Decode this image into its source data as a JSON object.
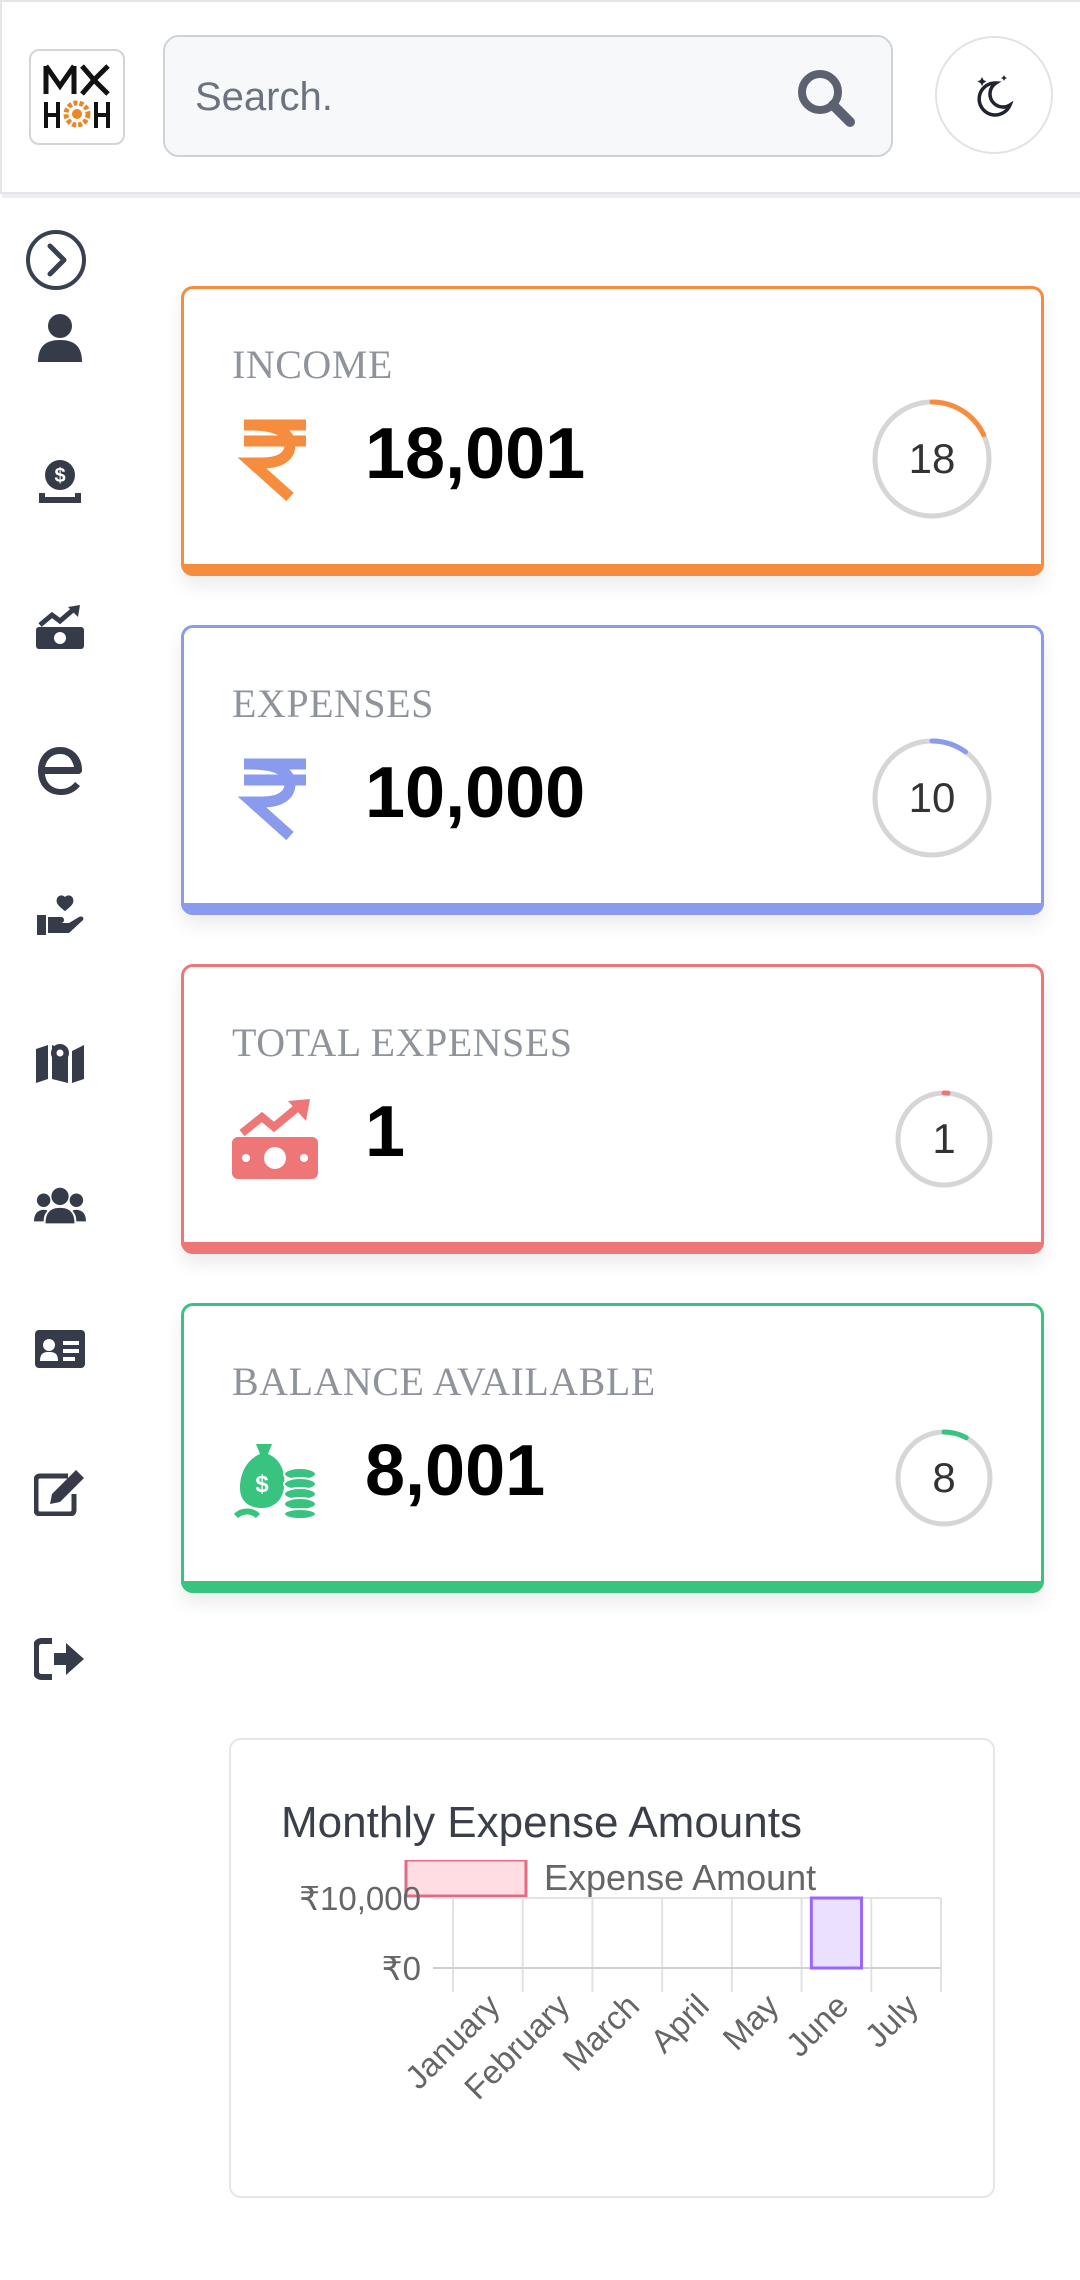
{
  "header": {
    "search_placeholder": "Search.",
    "icons": {
      "logo": "app-logo",
      "search": "search-icon",
      "theme": "moon-stars-icon"
    }
  },
  "sidebar": {
    "toggle_icon": "chevron-right-circle-icon",
    "items": [
      {
        "name": "user",
        "icon": "user-icon"
      },
      {
        "name": "income",
        "icon": "money-hand-icon"
      },
      {
        "name": "expenses",
        "icon": "money-trend-icon"
      },
      {
        "name": "e-letter",
        "icon": "letter-e-icon"
      },
      {
        "name": "donate",
        "icon": "hand-heart-icon"
      },
      {
        "name": "map",
        "icon": "map-location-icon"
      },
      {
        "name": "users",
        "icon": "users-icon"
      },
      {
        "name": "id-card",
        "icon": "id-card-icon"
      },
      {
        "name": "edit",
        "icon": "edit-icon"
      },
      {
        "name": "logout",
        "icon": "sign-out-icon"
      }
    ]
  },
  "cards": [
    {
      "label": "INCOME",
      "value": "18,001",
      "ring_value": "18",
      "ring_fraction": 0.18,
      "color": "#f68c3e",
      "icon": "rupee-icon"
    },
    {
      "label": "EXPENSES",
      "value": "10,000",
      "ring_value": "10",
      "ring_fraction": 0.1,
      "color": "#8a9bee",
      "icon": "rupee-icon"
    },
    {
      "label": "TOTAL EXPENSES",
      "value": "1",
      "ring_value": "1",
      "ring_fraction": 0.01,
      "color": "#ef7676",
      "icon": "money-trend-icon"
    },
    {
      "label": "BALANCE AVAILABLE",
      "value": "8,001",
      "ring_value": "8",
      "ring_fraction": 0.08,
      "color": "#38c37f",
      "icon": "money-bag-coins-icon"
    }
  ],
  "chart_data": {
    "type": "bar",
    "title": "Monthly Expense Amounts",
    "categories": [
      "January",
      "February",
      "March",
      "April",
      "May",
      "June",
      "July"
    ],
    "series": [
      {
        "name": "Expense Amount",
        "values": [
          0,
          0,
          0,
          0,
          0,
          10000,
          0
        ],
        "color": "#9966ff",
        "fill": "#ebe0ff"
      }
    ],
    "legend_swatch": {
      "fill": "#ffdde3",
      "stroke": "#e06b84"
    },
    "y_ticks": [
      "₹10,000",
      "₹0"
    ],
    "ylim": [
      0,
      10000
    ],
    "grid": true,
    "legend": "top"
  }
}
